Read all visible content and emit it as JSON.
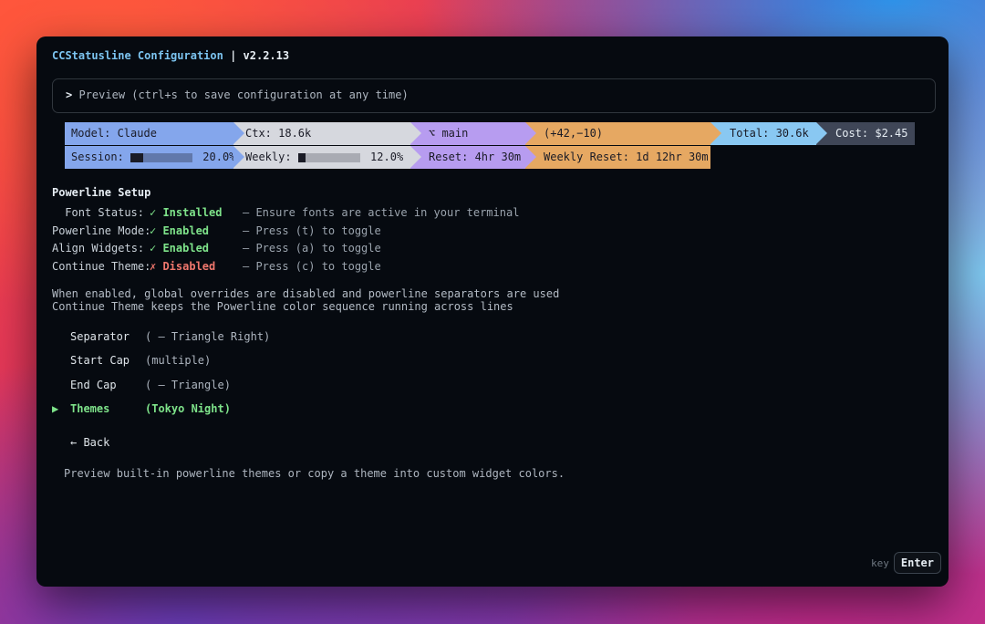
{
  "window": {
    "app_name": "CCStatusline Configuration",
    "version": "| v2.2.13"
  },
  "preview": {
    "prompt": ">",
    "text": "Preview (ctrl+s to save configuration at any time)"
  },
  "powerline_preview": {
    "row1": [
      {
        "text": "Model: Claude",
        "color": "#84a6ec"
      },
      {
        "text": "Ctx: 18.6k",
        "color": "#d6d8de"
      },
      {
        "text": "⌥ main",
        "color": "#b79cf0"
      },
      {
        "text": "(+42,−10)",
        "color": "#e6a862"
      },
      {
        "text": "Total: 30.6k",
        "color": "#89c8f2"
      },
      {
        "text": "Cost: $2.45",
        "color": "#3f4657"
      }
    ],
    "row2": [
      {
        "label": "Session:",
        "percent": "20.0%",
        "color": "#84a6ec"
      },
      {
        "label": "Weekly:",
        "percent": "12.0%",
        "color": "#d6d8de"
      },
      {
        "text": "Reset: 4hr 30m",
        "color": "#b79cf0"
      },
      {
        "text": "Weekly Reset: 1d 12hr 30m",
        "color": "#e6a862"
      }
    ]
  },
  "powerline_setup": {
    "title": "Powerline Setup",
    "rows": [
      {
        "label": "Font Status:",
        "value": "✓ Installed",
        "state": "ok",
        "hint": "– Ensure fonts are active in your terminal"
      },
      {
        "label": "Powerline Mode:",
        "value": "✓ Enabled",
        "state": "ok",
        "hint": "– Press (t) to toggle"
      },
      {
        "label": "Align Widgets:",
        "value": "✓ Enabled",
        "state": "ok",
        "hint": "– Press (a) to toggle"
      },
      {
        "label": "Continue Theme:",
        "value": "✗ Disabled",
        "state": "bad",
        "hint": "– Press (c) to toggle"
      }
    ],
    "note1": "When enabled, global overrides are disabled and powerline separators are used",
    "note2": "Continue Theme keeps the Powerline color sequence running across lines"
  },
  "menu": {
    "items": [
      {
        "name": "Separator",
        "desc": "( – Triangle Right)"
      },
      {
        "name": "Start Cap",
        "desc": "(multiple)"
      },
      {
        "name": "End Cap",
        "desc": "( – Triangle)"
      },
      {
        "name": "Themes",
        "desc": "(Tokyo Night)",
        "pointer": "▶"
      }
    ],
    "back": "← Back"
  },
  "help_text": "Preview built-in powerline themes or copy a theme into custom widget colors.",
  "key_hint": {
    "label": "key",
    "key": "Enter"
  },
  "colors": {
    "accent_green": "#7ee38a",
    "accent_red": "#f0776d",
    "title_blue": "#7cc4f0"
  }
}
